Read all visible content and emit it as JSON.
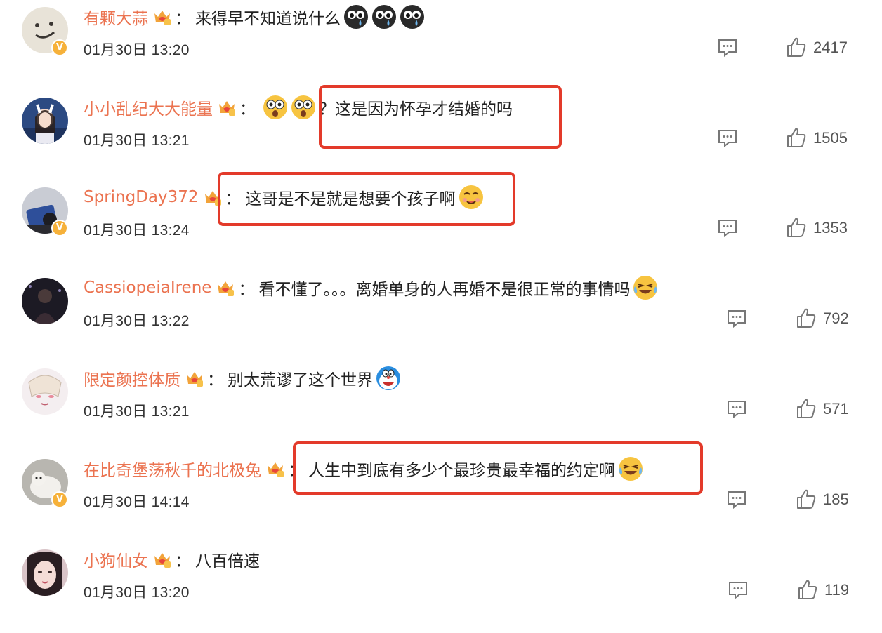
{
  "comments": [
    {
      "username": "有颗大蒜",
      "text": "来得早不知道说什么",
      "time": "01月30日 13:20",
      "likes": "2417",
      "verified": true,
      "emojis": [
        "cry-face-emoji",
        "cry-face-emoji",
        "cry-face-emoji"
      ]
    },
    {
      "username": "小小乱纪大大能量",
      "text": "？这是因为怀孕才结婚的吗",
      "time": "01月30日 13:21",
      "likes": "1505",
      "verified": false,
      "emojis": [
        "shocked-face-emoji",
        "shocked-face-emoji"
      ]
    },
    {
      "username": "SpringDay372",
      "text": "这哥是不是就是想要个孩子啊",
      "time": "01月30日 13:24",
      "likes": "1353",
      "verified": true,
      "emojis": [
        "yummy-face-emoji"
      ]
    },
    {
      "username": "CassiopeiaIrene",
      "text": "看不懂了。。。离婚单身的人再婚不是很正常的事情吗",
      "time": "01月30日 13:22",
      "likes": "792",
      "verified": false,
      "emojis": [
        "laugh-cry-emoji"
      ]
    },
    {
      "username": "限定颜控体质",
      "text": "别太荒谬了这个世界",
      "time": "01月30日 13:21",
      "likes": "571",
      "verified": false,
      "emojis": [
        "doraemon-emoji"
      ]
    },
    {
      "username": "在比奇堡荡秋千的北极兔",
      "text": "人生中到底有多少个最珍贵最幸福的约定啊",
      "time": "01月30日 14:14",
      "likes": "185",
      "verified": true,
      "emojis": [
        "laugh-cry-emoji"
      ]
    },
    {
      "username": "小狗仙女",
      "text": "八百倍速",
      "time": "01月30日 13:20",
      "likes": "119",
      "verified": false,
      "emojis": []
    }
  ],
  "colors": {
    "username": "#eb7350",
    "highlight": "#e33a2a",
    "verified_badge": "#f6b13a"
  }
}
